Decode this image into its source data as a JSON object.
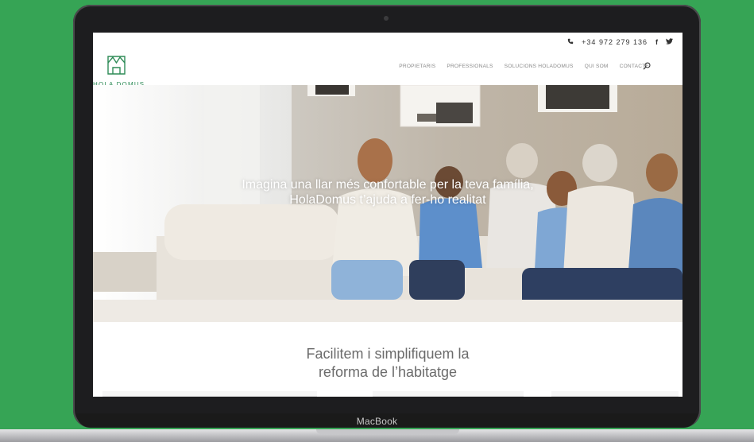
{
  "device": {
    "brand": "MacBook"
  },
  "topbar": {
    "phone": "+34 972 279 136",
    "facebook": "f",
    "twitter": "t"
  },
  "logo": {
    "text": "HOLA DOMUS"
  },
  "nav": {
    "items": [
      "PROPIETARIS",
      "PROFESSIONALS",
      "SOLUCIONS HOLADOMUS",
      "QUI SOM",
      "CONTACTE"
    ]
  },
  "hero": {
    "line1": "Imagina una llar més confortable per la teva família,",
    "line2": "HolaDomus t’ajuda a fer-ho realitat"
  },
  "section": {
    "line1": "Facilitem i simplifiquem la",
    "line2": "reforma de l’habitatge"
  },
  "colors": {
    "background": "#36a455",
    "brand_green": "#2e8b57"
  }
}
